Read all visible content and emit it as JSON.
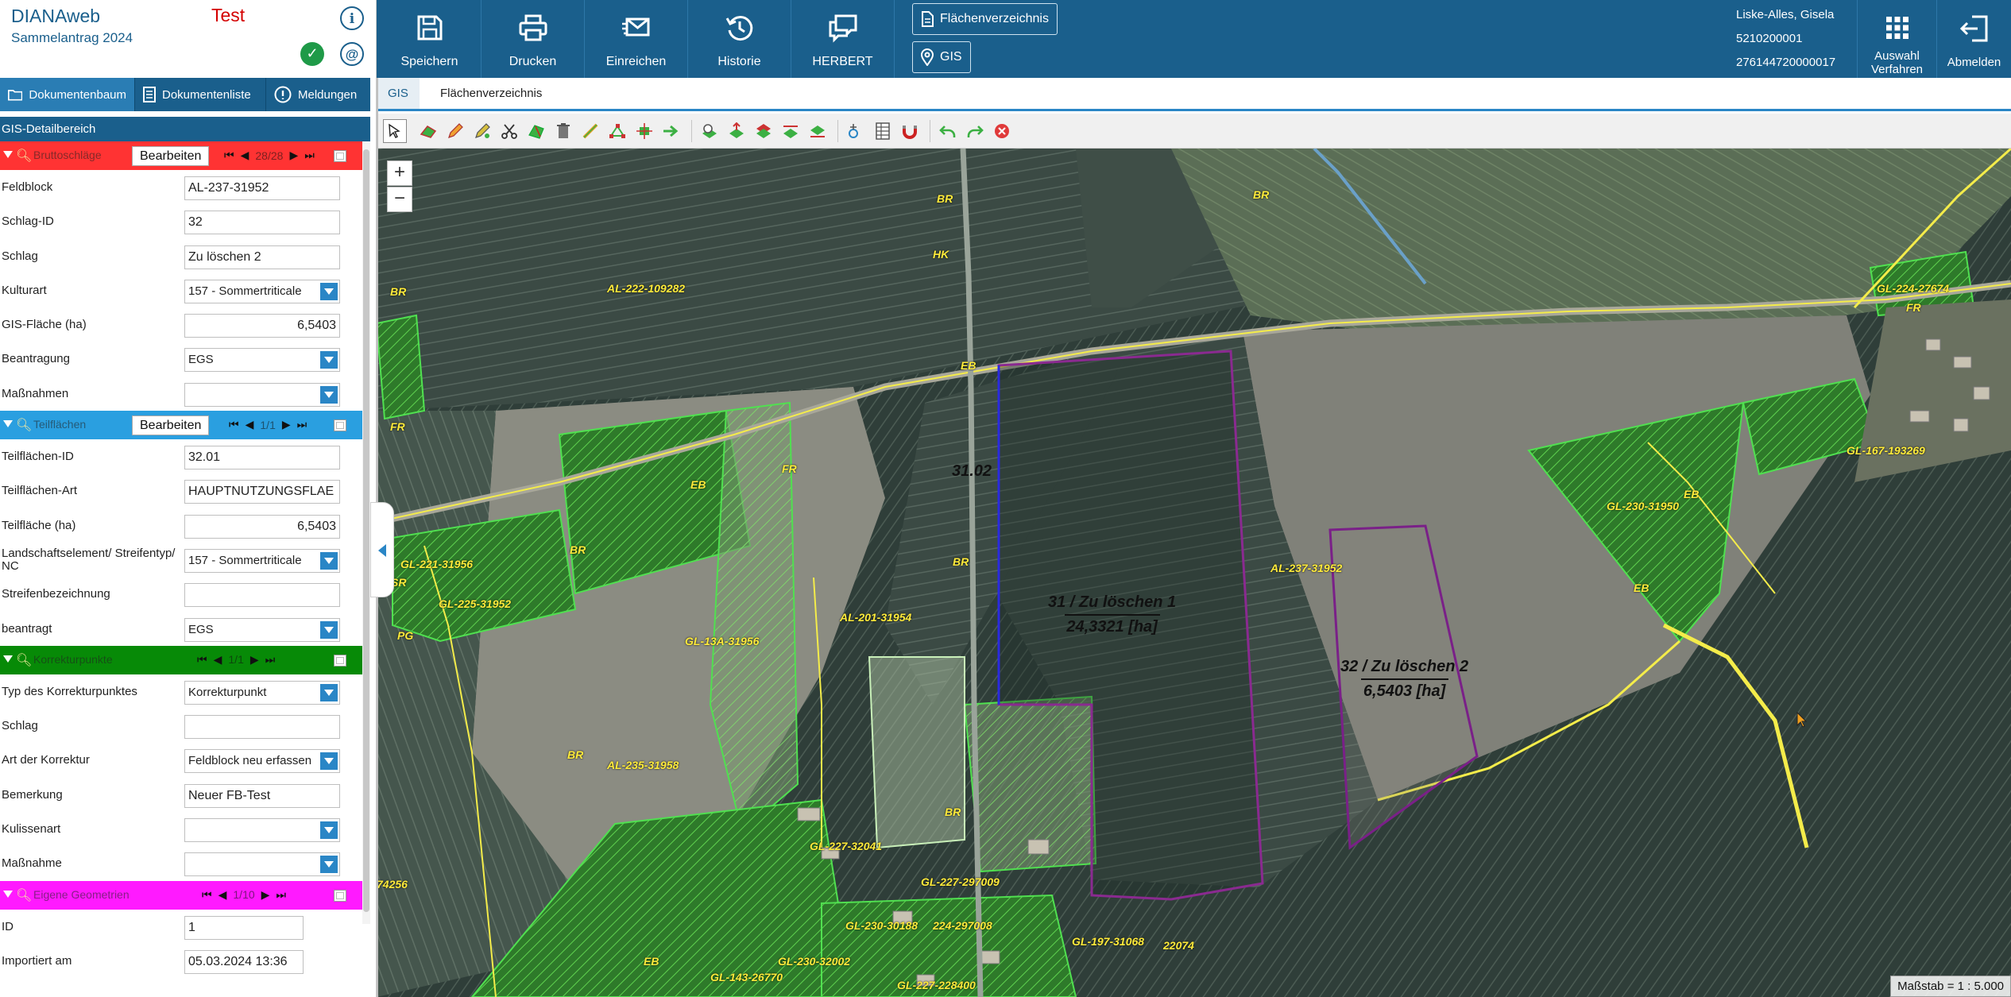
{
  "brand": {
    "app_name": "DIANAweb",
    "subtitle": "Sammelantrag 2024",
    "env_label": "Test"
  },
  "left_tabs": [
    {
      "label": "Dokumentenbaum",
      "icon": "folder-icon"
    },
    {
      "label": "Dokumentenliste",
      "icon": "document-list-icon"
    },
    {
      "label": "Meldungen",
      "icon": "info-icon"
    }
  ],
  "gis_detail_title": "GIS-Detailbereich",
  "sections": {
    "brutto": {
      "title": "Bruttoschläge",
      "edit": "Bearbeiten",
      "page": "28/28",
      "color": "#ff3333",
      "fields": {
        "feldblock": {
          "label": "Feldblock",
          "value": "AL-237-31952"
        },
        "schlag_id": {
          "label": "Schlag-ID",
          "value": "32"
        },
        "schlag": {
          "label": "Schlag",
          "value": "Zu löschen 2"
        },
        "kulturart": {
          "label": "Kulturart",
          "value": "157 - Sommertriticale"
        },
        "gis_flaeche": {
          "label": "GIS-Fläche (ha)",
          "value": "6,5403"
        },
        "beantragung": {
          "label": "Beantragung",
          "value": "EGS"
        },
        "massnahmen": {
          "label": "Maßnahmen",
          "value": ""
        }
      }
    },
    "teil": {
      "title": "Teilflächen",
      "edit": "Bearbeiten",
      "page": "1/1",
      "color": "#2a9fe0",
      "fields": {
        "tf_id": {
          "label": "Teilflächen-ID",
          "value": "32.01"
        },
        "tf_art": {
          "label": "Teilflächen-Art",
          "value": "HAUPTNUTZUNGSFLAE"
        },
        "tf_ha": {
          "label": "Teilfläche (ha)",
          "value": "6,5403"
        },
        "landschaft": {
          "label": "Landschaftselement/ Streifentyp/ NC",
          "value": "157 - Sommertriticale"
        },
        "streifen": {
          "label": "Streifenbezeichnung",
          "value": ""
        },
        "beantragt": {
          "label": "beantragt",
          "value": "EGS"
        }
      }
    },
    "korr": {
      "title": "Korrekturpunkte",
      "page": "1/1",
      "color": "#078a07",
      "fields": {
        "typ": {
          "label": "Typ des Korrekturpunktes",
          "value": "Korrekturpunkt"
        },
        "schlag": {
          "label": "Schlag",
          "value": ""
        },
        "art": {
          "label": "Art der Korrektur",
          "value": "Feldblock neu erfassen"
        },
        "bemerkung": {
          "label": "Bemerkung",
          "value": "Neuer FB-Test"
        },
        "kulisse": {
          "label": "Kulissenart",
          "value": ""
        },
        "massnahme": {
          "label": "Maßnahme",
          "value": ""
        }
      }
    },
    "eigen": {
      "title": "Eigene Geometrien",
      "page": "1/10",
      "color": "#ff1aff",
      "fields": {
        "id": {
          "label": "ID",
          "value": "1"
        },
        "importiert": {
          "label": "Importiert am",
          "value": "05.03.2024 13:36"
        }
      }
    }
  },
  "toolbar": {
    "speichern": "Speichern",
    "drucken": "Drucken",
    "einreichen": "Einreichen",
    "historie": "Historie",
    "herbert": "HERBERT",
    "flaechenverzeichnis": "Flächenverzeichnis",
    "gis": "GIS",
    "auswahl": "Auswahl Verfahren",
    "abmelden": "Abmelden"
  },
  "user": {
    "name": "Liske-Alles, Gisela",
    "id1": "5210200001",
    "id2": "276144720000017"
  },
  "map_tabs": [
    {
      "label": "GIS"
    },
    {
      "label": "Flächenverzeichnis"
    }
  ],
  "map": {
    "zoom_in": "+",
    "zoom_out": "−",
    "parcel_31": {
      "title": "31 / Zu löschen 1",
      "area": "24,3321 [ha]"
    },
    "parcel_32": {
      "title": "32 / Zu löschen 2",
      "area": "6,5403 [ha]"
    },
    "parcel_3102": "31.02",
    "field_labels": [
      "AL-222-109282",
      "AL-237-31952",
      "AL-201-31954",
      "AL-235-31958",
      "GL-13A-31956",
      "GL-221-31956",
      "GL-225-31952",
      "GL-230-31950",
      "GL-167-193269",
      "GL-224-27674",
      "GL-227-32041",
      "GL-227-297009",
      "GL-230-30188",
      "224-297008",
      "GL-197-31068",
      "22074",
      "GL-230-32002",
      "GL-143-26770",
      "GL-227-228400",
      "74256"
    ],
    "code_labels": [
      "BR",
      "HK",
      "EB",
      "FR",
      "SR",
      "PG"
    ],
    "scale": "Maßstab = 1 : 5.000"
  }
}
